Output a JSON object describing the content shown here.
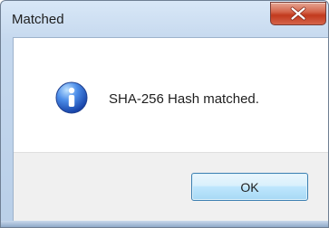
{
  "window": {
    "title": "Matched"
  },
  "message": {
    "text": "SHA-256 Hash matched."
  },
  "buttons": {
    "ok_label": "OK"
  },
  "icons": {
    "close": "close-icon",
    "information": "info-icon"
  },
  "colors": {
    "close_button": "#c2391d",
    "info_icon": "#2f61c7",
    "button_border": "#3c7fb1",
    "title_background": "#c5d8ee"
  }
}
